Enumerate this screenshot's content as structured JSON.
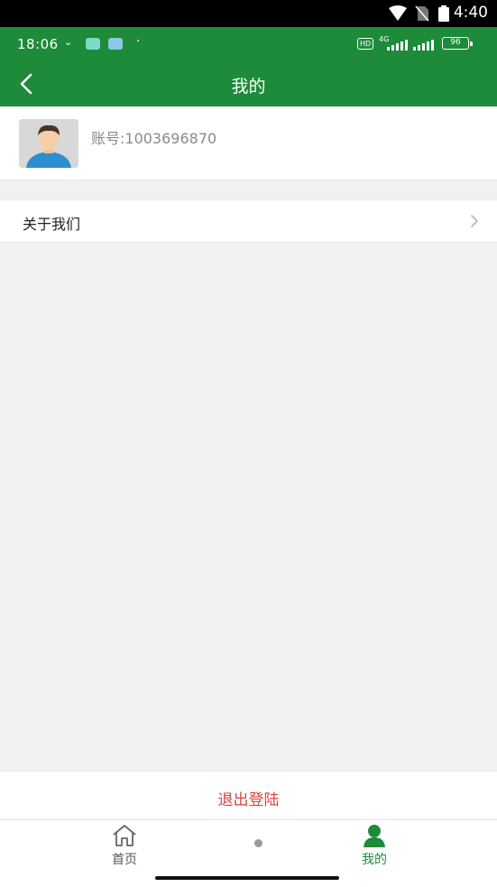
{
  "system_bar": {
    "time": "4:40"
  },
  "phone_status": {
    "time": "18:06",
    "hd_label": "HD",
    "network_label": "4G",
    "battery": "96"
  },
  "header": {
    "title": "我的",
    "back_icon": "chevron-left-icon"
  },
  "profile": {
    "account_label": "账号:1003696870",
    "avatar_icon": "user-avatar-icon"
  },
  "menu": {
    "about_label": "关于我们",
    "arrow_icon": "chevron-right-icon"
  },
  "logout": {
    "label": "退出登陆"
  },
  "tabs": [
    {
      "label": "首页",
      "icon": "home-icon"
    },
    {
      "label": "我的",
      "icon": "person-icon"
    }
  ],
  "colors": {
    "brand_green": "#1d8b3a",
    "logout_red": "#d9443f"
  }
}
